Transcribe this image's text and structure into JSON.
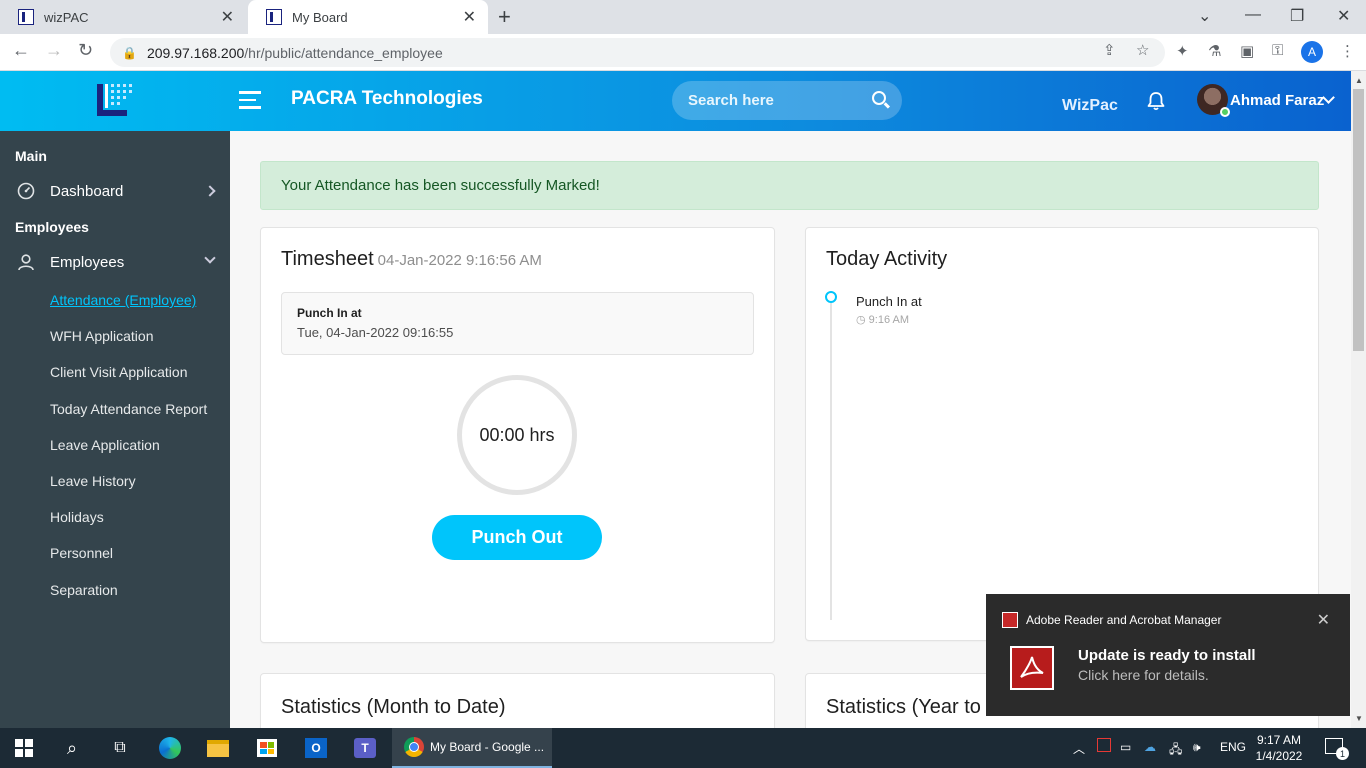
{
  "browser": {
    "tabs": [
      {
        "label": "wizPAC"
      },
      {
        "label": "My Board"
      }
    ],
    "url_host": "209.97.168.200",
    "url_path": "/hr/public/attendance_employee",
    "profile_initial": "A"
  },
  "header": {
    "company": "PACRA Technologies",
    "search_placeholder": "Search here",
    "wizpac_link": "WizPac",
    "username": "Ahmad Faraz"
  },
  "sidebar": {
    "section_main": "Main",
    "dashboard": "Dashboard",
    "section_employees": "Employees",
    "employees": "Employees",
    "sub_items": [
      {
        "label": "Attendance (Employee)"
      },
      {
        "label": "WFH Application"
      },
      {
        "label": "Client Visit Application"
      },
      {
        "label": "Today Attendance Report"
      },
      {
        "label": "Leave Application"
      },
      {
        "label": "Leave History"
      },
      {
        "label": "Holidays"
      },
      {
        "label": "Personnel"
      },
      {
        "label": "Separation"
      }
    ]
  },
  "main": {
    "alert": "Your Attendance has been successfully Marked!",
    "timesheet": {
      "title": "Timesheet",
      "datetime": "04-Jan-2022 9:16:56 AM",
      "punch_in_label": "Punch In at",
      "punch_in_value": "Tue, 04-Jan-2022 09:16:55",
      "hours": "00:00 hrs",
      "punch_out_label": "Punch Out"
    },
    "activity": {
      "title": "Today Activity",
      "item_title": "Punch In at",
      "item_time": "9:16 AM"
    },
    "stats_month_title": "Statistics (Month to Date)",
    "stats_year_title": "Statistics (Year to"
  },
  "toast": {
    "app_name": "Adobe Reader and Acrobat Manager",
    "title": "Update is ready to install",
    "body": "Click here for details."
  },
  "taskbar": {
    "active_window": "My Board - Google ...",
    "lang": "ENG",
    "time": "9:17 AM",
    "date": "1/4/2022",
    "notification_count": "1"
  }
}
